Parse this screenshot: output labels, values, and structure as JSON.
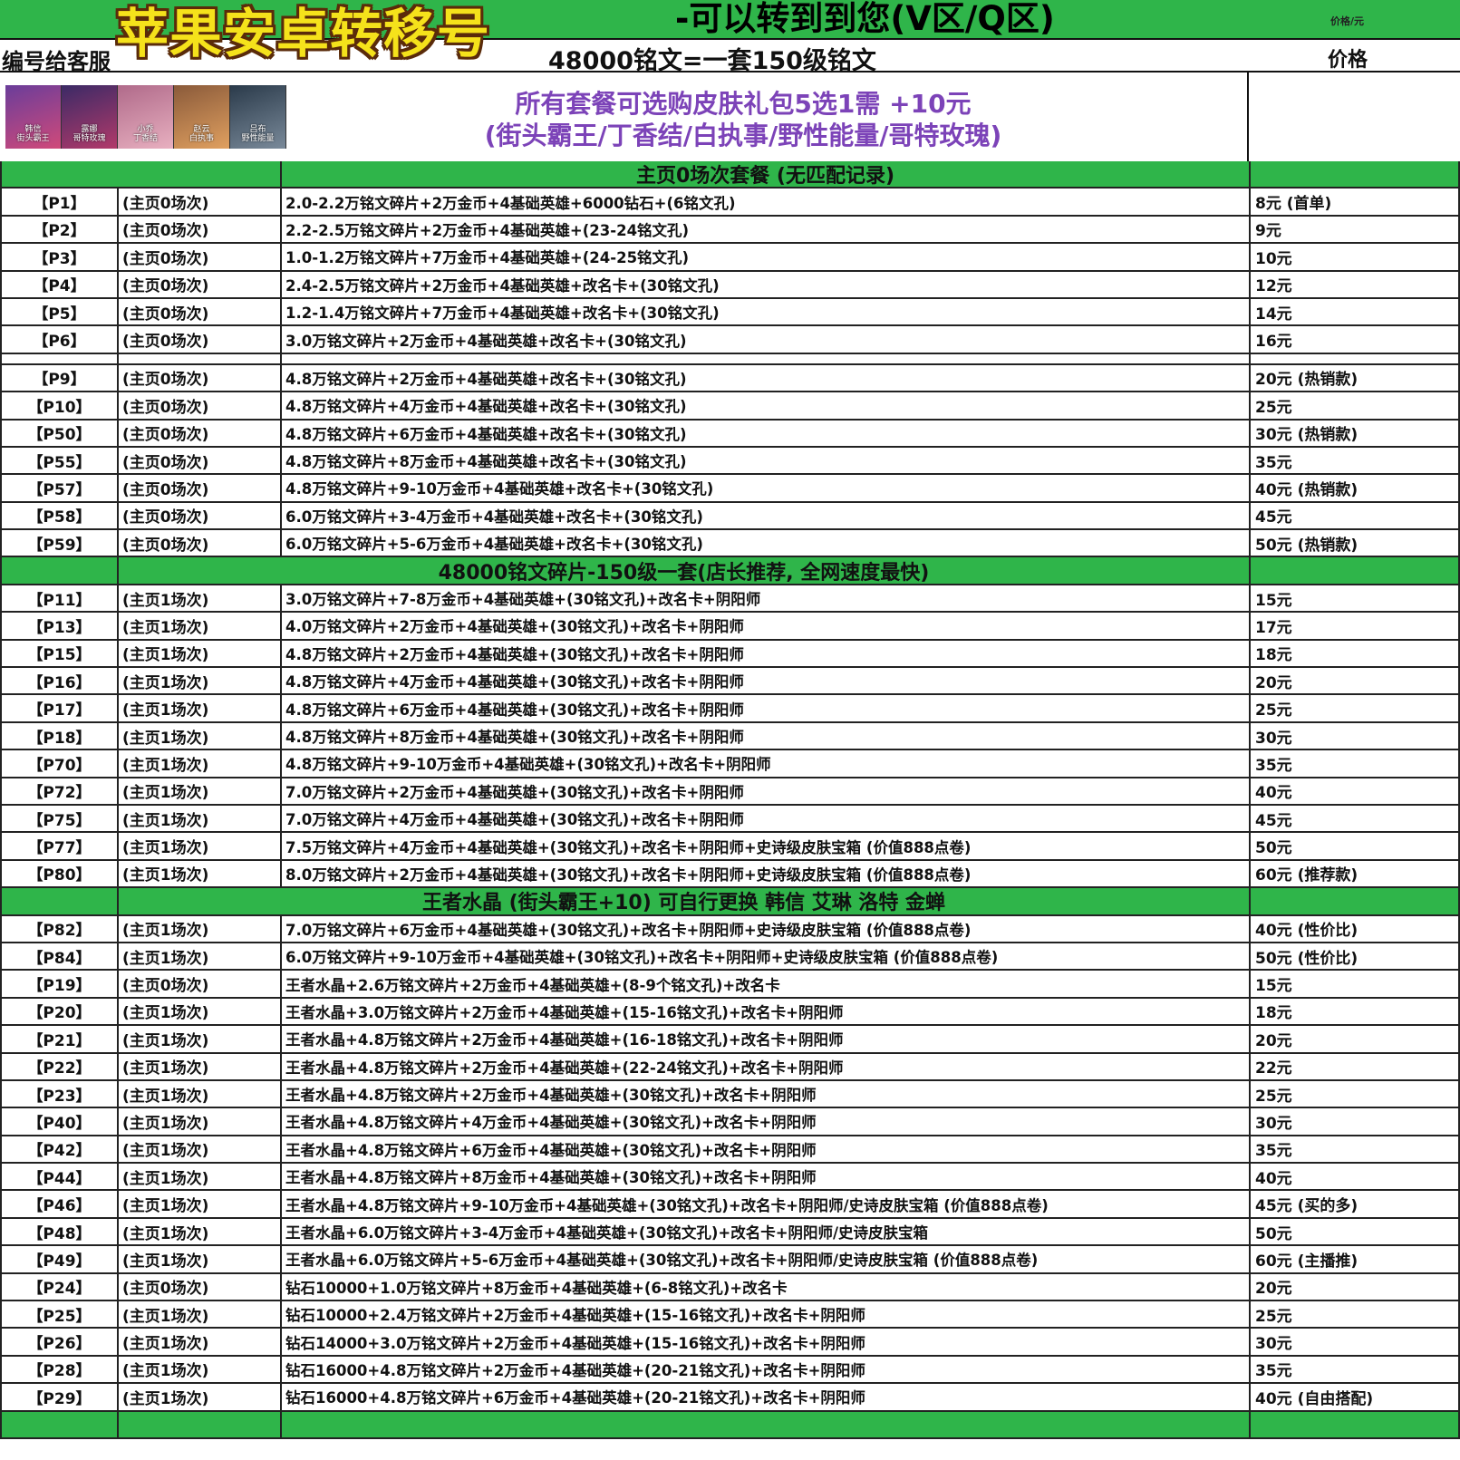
{
  "header": {
    "title": "苹果安卓转移号",
    "transfer_note": "-可以转到到您(V区/Q区)",
    "price_unit": "价格/元",
    "code_note": "编号给客服",
    "rune_formula": "48000铭文=一套150级铭文",
    "price_label": "价格",
    "bg_color": "#2fb54a",
    "title_color": "#f5e21b"
  },
  "promo": {
    "line1": "所有套餐可选购皮肤礼包5选1需 +10元",
    "line2": "(街头霸王/丁香结/白执事/野性能量/哥特玫瑰)",
    "color": "#7c43b8",
    "heroes": [
      {
        "name": "韩信",
        "skin": "街头霸王"
      },
      {
        "name": "露娜",
        "skin": "哥特玫瑰"
      },
      {
        "name": "小乔",
        "skin": "丁香结"
      },
      {
        "name": "赵云",
        "skin": "白执事"
      },
      {
        "name": "吕布",
        "skin": "野性能量"
      }
    ]
  },
  "sections": [
    {
      "title": "主页0场次套餐 (无匹配记录)",
      "rows": [
        {
          "code": "【P1】",
          "note": "(主页0场次)",
          "desc": "2.0-2.2万铭文碎片+2万金币+4基础英雄+6000钻石+(6铭文孔)",
          "price": "8元 (首单)"
        },
        {
          "code": "【P2】",
          "note": "(主页0场次)",
          "desc": "2.2-2.5万铭文碎片+2万金币+4基础英雄+(23-24铭文孔)",
          "price": "9元"
        },
        {
          "code": "【P3】",
          "note": "(主页0场次)",
          "desc": "1.0-1.2万铭文碎片+7万金币+4基础英雄+(24-25铭文孔)",
          "price": "10元"
        },
        {
          "code": "【P4】",
          "note": "(主页0场次)",
          "desc": "2.4-2.5万铭文碎片+2万金币+4基础英雄+改名卡+(30铭文孔)",
          "price": "12元"
        },
        {
          "code": "【P5】",
          "note": "(主页0场次)",
          "desc": "1.2-1.4万铭文碎片+7万金币+4基础英雄+改名卡+(30铭文孔)",
          "price": "14元"
        },
        {
          "code": "【P6】",
          "note": "(主页0场次)",
          "desc": "3.0万铭文碎片+2万金币+4基础英雄+改名卡+(30铭文孔)",
          "price": "16元",
          "gap_after": true
        },
        {
          "code": "【P9】",
          "note": "(主页0场次)",
          "desc": "4.8万铭文碎片+2万金币+4基础英雄+改名卡+(30铭文孔)",
          "price": "20元 (热销款)"
        },
        {
          "code": "【P10】",
          "note": "(主页0场次)",
          "desc": "4.8万铭文碎片+4万金币+4基础英雄+改名卡+(30铭文孔)",
          "price": "25元"
        },
        {
          "code": "【P50】",
          "note": "(主页0场次)",
          "desc": "4.8万铭文碎片+6万金币+4基础英雄+改名卡+(30铭文孔)",
          "price": "30元 (热销款)"
        },
        {
          "code": "【P55】",
          "note": "(主页0场次)",
          "desc": "4.8万铭文碎片+8万金币+4基础英雄+改名卡+(30铭文孔)",
          "price": "35元"
        },
        {
          "code": "【P57】",
          "note": "(主页0场次)",
          "desc": "4.8万铭文碎片+9-10万金币+4基础英雄+改名卡+(30铭文孔)",
          "price": "40元 (热销款)"
        },
        {
          "code": "【P58】",
          "note": "(主页0场次)",
          "desc": "6.0万铭文碎片+3-4万金币+4基础英雄+改名卡+(30铭文孔)",
          "price": "45元"
        },
        {
          "code": "【P59】",
          "note": "(主页0场次)",
          "desc": "6.0万铭文碎片+5-6万金币+4基础英雄+改名卡+(30铭文孔)",
          "price": "50元 (热销款)"
        }
      ]
    },
    {
      "title": "48000铭文碎片-150级一套(店长推荐, 全网速度最快)",
      "rows": [
        {
          "code": "【P11】",
          "note": "(主页1场次)",
          "desc": "3.0万铭文碎片+7-8万金币+4基础英雄+(30铭文孔)+改名卡+阴阳师",
          "price": "15元"
        },
        {
          "code": "【P13】",
          "note": "(主页1场次)",
          "desc": "4.0万铭文碎片+2万金币+4基础英雄+(30铭文孔)+改名卡+阴阳师",
          "price": "17元"
        },
        {
          "code": "【P15】",
          "note": "(主页1场次)",
          "desc": "4.8万铭文碎片+2万金币+4基础英雄+(30铭文孔)+改名卡+阴阳师",
          "price": "18元"
        },
        {
          "code": "【P16】",
          "note": "(主页1场次)",
          "desc": "4.8万铭文碎片+4万金币+4基础英雄+(30铭文孔)+改名卡+阴阳师",
          "price": "20元"
        },
        {
          "code": "【P17】",
          "note": "(主页1场次)",
          "desc": "4.8万铭文碎片+6万金币+4基础英雄+(30铭文孔)+改名卡+阴阳师",
          "price": "25元"
        },
        {
          "code": "【P18】",
          "note": "(主页1场次)",
          "desc": "4.8万铭文碎片+8万金币+4基础英雄+(30铭文孔)+改名卡+阴阳师",
          "price": "30元"
        },
        {
          "code": "【P70】",
          "note": "(主页1场次)",
          "desc": "4.8万铭文碎片+9-10万金币+4基础英雄+(30铭文孔)+改名卡+阴阳师",
          "price": "35元"
        },
        {
          "code": "【P72】",
          "note": "(主页1场次)",
          "desc": "7.0万铭文碎片+2万金币+4基础英雄+(30铭文孔)+改名卡+阴阳师",
          "price": "40元"
        },
        {
          "code": "【P75】",
          "note": "(主页1场次)",
          "desc": "7.0万铭文碎片+4万金币+4基础英雄+(30铭文孔)+改名卡+阴阳师",
          "price": "45元"
        },
        {
          "code": "【P77】",
          "note": "(主页1场次)",
          "desc": "7.5万铭文碎片+4万金币+4基础英雄+(30铭文孔)+改名卡+阴阳师+史诗级皮肤宝箱 (价值888点卷)",
          "price": "50元"
        },
        {
          "code": "【P80】",
          "note": "(主页1场次)",
          "desc": "8.0万铭文碎片+2万金币+4基础英雄+(30铭文孔)+改名卡+阴阳师+史诗级皮肤宝箱 (价值888点卷)",
          "price": "60元 (推荐款)"
        }
      ]
    },
    {
      "title": "王者水晶 (街头霸王+10) 可自行更换 韩信 艾琳 洛特 金蝉",
      "rows": [
        {
          "code": "【P82】",
          "note": "(主页1场次)",
          "desc": "7.0万铭文碎片+6万金币+4基础英雄+(30铭文孔)+改名卡+阴阳师+史诗级皮肤宝箱 (价值888点卷)",
          "price": "40元 (性价比)"
        },
        {
          "code": "【P84】",
          "note": "(主页1场次)",
          "desc": "6.0万铭文碎片+9-10万金币+4基础英雄+(30铭文孔)+改名卡+阴阳师+史诗级皮肤宝箱 (价值888点卷)",
          "price": "50元 (性价比)"
        },
        {
          "code": "【P19】",
          "note": "(主页0场次)",
          "desc": "王者水晶+2.6万铭文碎片+2万金币+4基础英雄+(8-9个铭文孔)+改名卡",
          "price": "15元"
        },
        {
          "code": "【P20】",
          "note": "(主页1场次)",
          "desc": "王者水晶+3.0万铭文碎片+2万金币+4基础英雄+(15-16铭文孔)+改名卡+阴阳师",
          "price": "18元"
        },
        {
          "code": "【P21】",
          "note": "(主页1场次)",
          "desc": "王者水晶+4.8万铭文碎片+2万金币+4基础英雄+(16-18铭文孔)+改名卡+阴阳师",
          "price": "20元"
        },
        {
          "code": "【P22】",
          "note": "(主页1场次)",
          "desc": "王者水晶+4.8万铭文碎片+2万金币+4基础英雄+(22-24铭文孔)+改名卡+阴阳师",
          "price": "22元"
        },
        {
          "code": "【P23】",
          "note": "(主页1场次)",
          "desc": "王者水晶+4.8万铭文碎片+2万金币+4基础英雄+(30铭文孔)+改名卡+阴阳师",
          "price": "25元"
        },
        {
          "code": "【P40】",
          "note": "(主页1场次)",
          "desc": "王者水晶+4.8万铭文碎片+4万金币+4基础英雄+(30铭文孔)+改名卡+阴阳师",
          "price": "30元"
        },
        {
          "code": "【P42】",
          "note": "(主页1场次)",
          "desc": "王者水晶+4.8万铭文碎片+6万金币+4基础英雄+(30铭文孔)+改名卡+阴阳师",
          "price": "35元"
        },
        {
          "code": "【P44】",
          "note": "(主页1场次)",
          "desc": "王者水晶+4.8万铭文碎片+8万金币+4基础英雄+(30铭文孔)+改名卡+阴阳师",
          "price": "40元"
        },
        {
          "code": "【P46】",
          "note": "(主页1场次)",
          "desc": "王者水晶+4.8万铭文碎片+9-10万金币+4基础英雄+(30铭文孔)+改名卡+阴阳师/史诗皮肤宝箱 (价值888点卷)",
          "price": "45元 (买的多)"
        },
        {
          "code": "【P48】",
          "note": "(主页1场次)",
          "desc": "王者水晶+6.0万铭文碎片+3-4万金币+4基础英雄+(30铭文孔)+改名卡+阴阳师/史诗皮肤宝箱",
          "price": "50元"
        },
        {
          "code": "【P49】",
          "note": "(主页1场次)",
          "desc": "王者水晶+6.0万铭文碎片+5-6万金币+4基础英雄+(30铭文孔)+改名卡+阴阳师/史诗皮肤宝箱 (价值888点卷)",
          "price": "60元 (主播推)"
        },
        {
          "code": "【P24】",
          "note": "(主页0场次)",
          "desc": "钻石10000+1.0万铭文碎片+8万金币+4基础英雄+(6-8铭文孔)+改名卡",
          "price": "20元"
        },
        {
          "code": "【P25】",
          "note": "(主页1场次)",
          "desc": "钻石10000+2.4万铭文碎片+2万金币+4基础英雄+(15-16铭文孔)+改名卡+阴阳师",
          "price": "25元"
        },
        {
          "code": "【P26】",
          "note": "(主页1场次)",
          "desc": "钻石14000+3.0万铭文碎片+2万金币+4基础英雄+(15-16铭文孔)+改名卡+阴阳师",
          "price": "30元"
        },
        {
          "code": "【P28】",
          "note": "(主页1场次)",
          "desc": "钻石16000+4.8万铭文碎片+2万金币+4基础英雄+(20-21铭文孔)+改名卡+阴阳师",
          "price": "35元"
        },
        {
          "code": "【P29】",
          "note": "(主页1场次)",
          "desc": "钻石16000+4.8万铭文碎片+6万金币+4基础英雄+(20-21铭文孔)+改名卡+阴阳师",
          "price": "40元 (自由搭配)"
        }
      ]
    }
  ]
}
